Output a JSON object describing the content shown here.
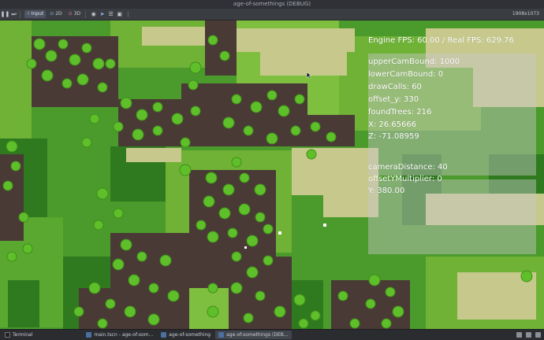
{
  "window": {
    "title": "age-of-somethings (DEBUG)",
    "resolution": "1908x1073"
  },
  "toolbar": {
    "input_label": "Input",
    "mode_2d": "2D",
    "mode_3d": "3D"
  },
  "hud": {
    "fps": "Engine FPS: 60.00 / Real FPS: 629.76",
    "lines_a": [
      "upperCamBound: 1000",
      "lowerCamBound: 0",
      "drawCalls: 60",
      "offset_y: 330",
      " foundTrees: 216",
      " X: 26.65666",
      " Z: -71.08959"
    ],
    "lines_b": [
      "cameraDistance: 40",
      "offsetYMultiplier: 0",
      "Y: 380.00"
    ]
  },
  "taskbar": {
    "items": [
      {
        "label": "Terminal",
        "icon": "terminal-icon"
      },
      {
        "label": "main.tscn - age-of-som...",
        "icon": "godot-icon"
      },
      {
        "label": "age-of-something",
        "icon": "godot-icon"
      },
      {
        "label": "age-of-somethings (DEB...",
        "icon": "godot-icon"
      }
    ]
  },
  "colors": {
    "grass_light": "#7fbf3f",
    "grass_mid": "#4a9a2c",
    "grass_dark": "#2f7a1e",
    "sand": "#c7c98c",
    "dirt": "#4a3a36",
    "tree": "#5fbf2a"
  }
}
